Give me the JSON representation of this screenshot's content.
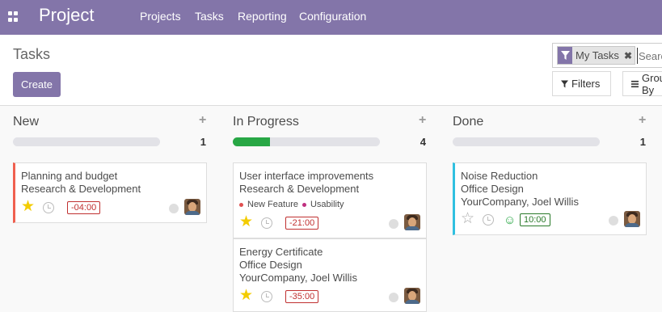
{
  "navbar": {
    "brand": "Project",
    "menu": [
      "Projects",
      "Tasks",
      "Reporting",
      "Configuration"
    ]
  },
  "control": {
    "title": "Tasks",
    "create_label": "Create",
    "search": {
      "facet_label": "My Tasks",
      "facet_close": "✖",
      "placeholder": "Search..."
    },
    "filters_label": "Filters",
    "group_label": "Group By"
  },
  "columns": [
    {
      "title": "New",
      "plus": "+",
      "count": "1",
      "progress": 0,
      "cards": [
        {
          "lines": [
            "Planning and budget",
            "Research & Development"
          ],
          "starred": true,
          "deadline": "-04:00",
          "deadline_status": "late",
          "color": "red"
        }
      ]
    },
    {
      "title": "In Progress",
      "plus": "+",
      "count": "4",
      "progress": 0.25,
      "cards": [
        {
          "lines": [
            "User interface improvements",
            "Research & Development"
          ],
          "tags": [
            {
              "label": "New Feature",
              "color": "#e05050"
            },
            {
              "label": "Usability",
              "color": "#c03080"
            }
          ],
          "starred": true,
          "deadline": "-21:00",
          "deadline_status": "late"
        },
        {
          "lines": [
            "Energy Certificate",
            "Office Design",
            "YourCompany, Joel Willis"
          ],
          "starred": true,
          "deadline": "-35:00",
          "deadline_status": "late"
        }
      ]
    },
    {
      "title": "Done",
      "plus": "+",
      "count": "1",
      "progress": 0,
      "cards": [
        {
          "lines": [
            "Noise Reduction",
            "Office Design",
            "YourCompany, Joel Willis"
          ],
          "starred": false,
          "deadline": "10:00",
          "deadline_status": "ok",
          "rating_icon": "smile-icon",
          "color": "blue"
        }
      ]
    }
  ],
  "colors": {
    "brand": "#8375a9",
    "star_on": "#f3cc00",
    "progress_done": "#28a745",
    "late": "#c03030",
    "ok": "#2a7a2a"
  }
}
